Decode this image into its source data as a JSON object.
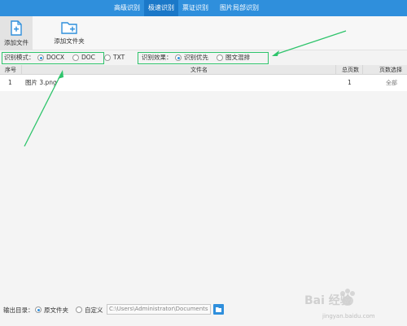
{
  "top_tabs": [
    {
      "label": "高级识别",
      "active": false
    },
    {
      "label": "极速识别",
      "active": true
    },
    {
      "label": "票证识别",
      "active": false
    },
    {
      "label": "图片局部识别",
      "active": false
    }
  ],
  "toolbar": {
    "add_file": "添加文件",
    "add_folder": "添加文件夹"
  },
  "options": {
    "mode_label": "识别模式：",
    "mode_options": [
      {
        "label": "DOCX",
        "selected": true
      },
      {
        "label": "DOC",
        "selected": false
      },
      {
        "label": "TXT",
        "selected": false
      }
    ],
    "effect_label": "识别效果：",
    "effect_options": [
      {
        "label": "识别优先",
        "selected": true
      },
      {
        "label": "图文混排",
        "selected": false
      }
    ]
  },
  "table": {
    "headers": {
      "index": "序号",
      "filename": "文件名",
      "total_pages": "总页数",
      "pages_to_convert": "页数选择"
    },
    "rows": [
      {
        "index": "1",
        "filename": "图片 3.png",
        "total_pages": "1",
        "pages_to_convert": "全部"
      }
    ]
  },
  "output": {
    "label": "输出目录：",
    "options": [
      {
        "label": "原文件夹",
        "selected": true
      },
      {
        "label": "自定义",
        "selected": false
      }
    ],
    "path": "C:\\Users\\Administrator\\Documents"
  },
  "watermark": {
    "text_cn": "Bai 经验",
    "text_url": "jingyan.baidu.com"
  },
  "colors": {
    "accent": "#2f8fdc",
    "highlight_box": "#2ec46b"
  }
}
